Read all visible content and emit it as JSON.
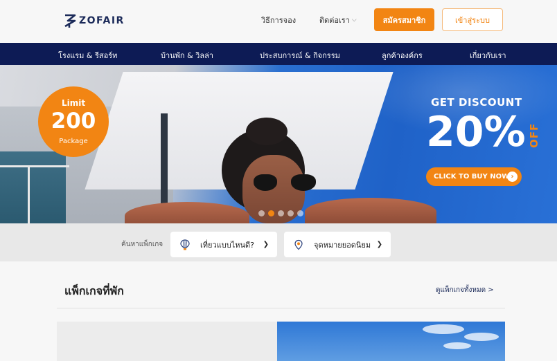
{
  "header": {
    "brand": "ZOFAIR",
    "nav_how_to_book": "วิธีการจอง",
    "nav_contact": "ติดต่อเรา",
    "register_label": "สมัครสมาชิก",
    "login_label": "เข้าสู่ระบบ"
  },
  "categories": [
    "โรงแรม & รีสอร์ท",
    "บ้านพัก & วิลล่า",
    "ประสบการณ์ & กิจกรรม",
    "ลูกค้าองค์กร",
    "เกี่ยวกับเรา"
  ],
  "banner": {
    "limit_label": "Limit",
    "limit_number": "200",
    "limit_sub": "Package",
    "discount_title": "GET DISCOUNT",
    "discount_value": "20%",
    "discount_off": "OFF",
    "buy_button": "CLICK TO BUY NOW",
    "slides_total": 5,
    "active_slide": 2
  },
  "search": {
    "label": "ค้นหาแพ็กเกจ",
    "travel_style": "เที่ยวแบบไหนดี?",
    "destination": "จุดหมายยอดนิยม"
  },
  "section": {
    "title": "แพ็กเกจที่พัก",
    "view_all": "ดูแพ็กเกจทั้งหมด >"
  },
  "colors": {
    "accent": "#f28513",
    "navy": "#0d1b55",
    "brand_text": "#1b2a59"
  },
  "icons": {
    "logo": "zofair-logo-icon",
    "contact_dropdown": "chevron-down-icon",
    "travel_style": "hot-air-balloon-icon",
    "destination": "map-pin-icon",
    "buy_arrow": "arrow-right-circle-icon"
  }
}
